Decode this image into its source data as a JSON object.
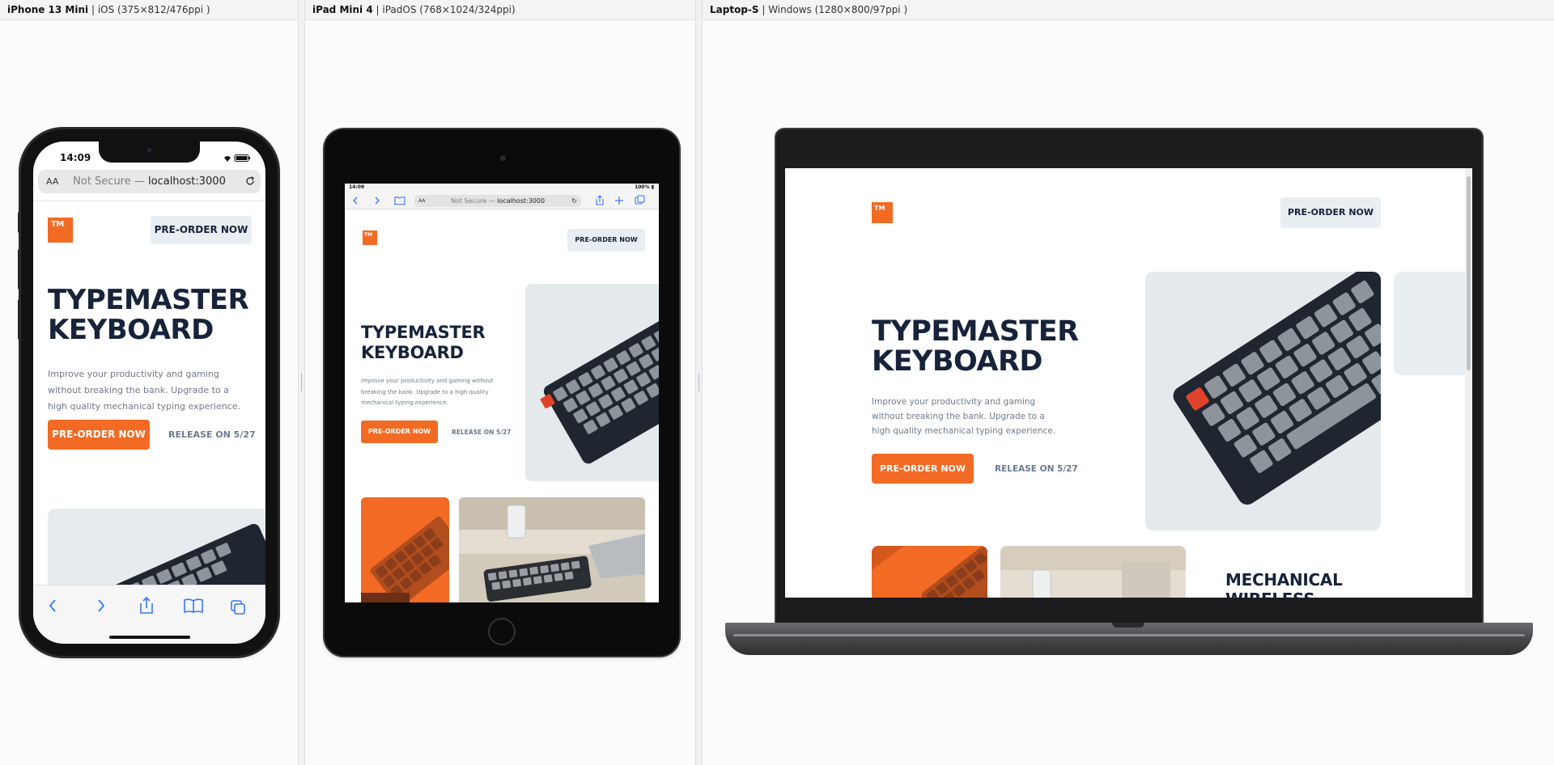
{
  "devices": {
    "phone": {
      "name": "iPhone 13 Mini",
      "spec": " | iOS (375×812/476ppi )"
    },
    "tablet": {
      "name": "iPad Mini 4",
      "spec": " | iPadOS (768×1024/324ppi)"
    },
    "laptop": {
      "name": "Laptop-S",
      "spec": " | Windows (1280×800/97ppi )"
    }
  },
  "browser": {
    "time": "14:09",
    "text_size": "AA",
    "not_secure": "Not Secure —",
    "host": "localhost:3000",
    "battery": "100%"
  },
  "site": {
    "logo": "TM",
    "nav_button": "PRE-ORDER NOW",
    "title_line1": "TYPEMASTER",
    "title_line2": "KEYBOARD",
    "description": "Improve your productivity and gaming without breaking the bank. Upgrade to a high quality mechanical typing experience.",
    "cta_button": "PRE-ORDER NOW",
    "release": "RELEASE ON 5/27",
    "section_title_line1": "MECHANICAL",
    "section_title_line2": "WIRELESS"
  },
  "colors": {
    "accent": "#f26a24",
    "navy": "#17233a",
    "muted": "#6b7b8f",
    "button_bg": "#e8eef2"
  },
  "icons": [
    "back-icon",
    "forward-icon",
    "share-icon",
    "bookmarks-icon",
    "tabs-icon",
    "reload-icon",
    "wifi-icon",
    "battery-icon",
    "add-tab-icon"
  ]
}
